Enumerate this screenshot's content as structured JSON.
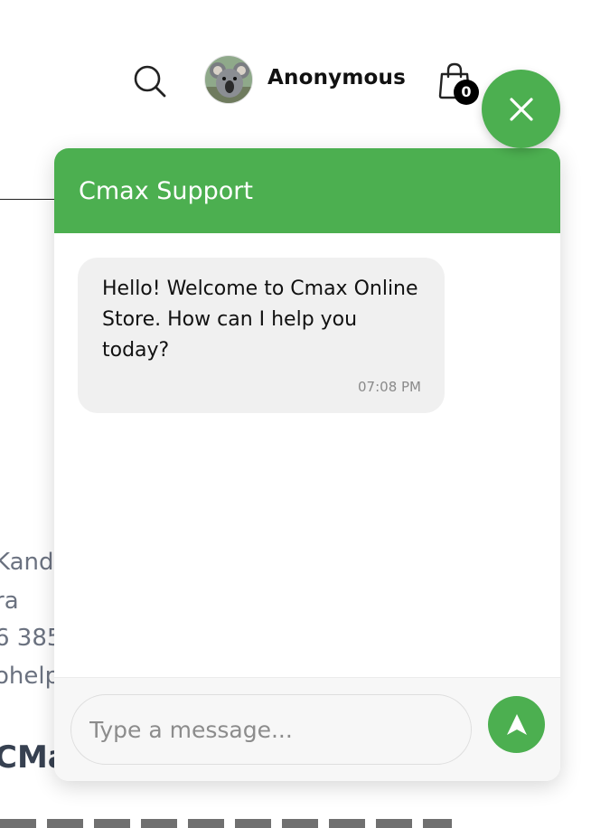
{
  "header": {
    "user_name": "Anonymous",
    "cart_count": "0"
  },
  "background": {
    "lines": [
      "Kand",
      "ra",
      "6 385",
      "ohelp"
    ],
    "heading": "CMa"
  },
  "chat": {
    "title": "Cmax Support",
    "messages": [
      {
        "text": "Hello! Welcome to Cmax Online Store. How can I help you today?",
        "time": "07:08 PM"
      }
    ],
    "input_placeholder": "Type a message...",
    "input_value": ""
  },
  "colors": {
    "accent": "#4caf50",
    "bubble": "#f0f0f0",
    "badge": "#000000"
  },
  "icons": [
    "search-icon",
    "avatar-koala",
    "shopping-bag-icon",
    "close-icon",
    "send-icon"
  ]
}
